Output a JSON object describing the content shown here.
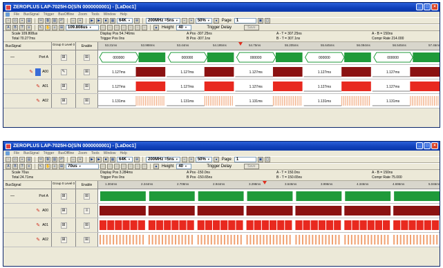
{
  "windows": [
    {
      "id": "win1",
      "title": "ZEROPLUS LAP-7025H-D(S/N 0000000001) - [LaDoc1]",
      "menu": [
        "File",
        "BusSignal",
        "Trigger",
        "BusOffline",
        "Zoom",
        "Tools",
        "Window",
        "Help"
      ],
      "toolbar1": {
        "mem_depth": "64K",
        "sample_rate": "200MHz =5ns",
        "zoom": "50%",
        "page_label": "Page",
        "page_value": "1"
      },
      "toolbar2": {
        "time_value": "109.808us",
        "height_label": "Height",
        "height_value": "40",
        "trigger_delay_label": "Trigger Delay",
        "trigger_delay_btn": "Save"
      },
      "status": {
        "scale": "Scale 109.808us",
        "total": "Total 70.277ms",
        "display_pos": "Display Pos 54.746ms",
        "trigger_pos": "Trigger Pos 0ns",
        "a_pos": "A Pos -307.25ns",
        "b_pos": "B Pos -307.1ns",
        "a_t": "A - T = 307.25ns",
        "b_t": "B - T = 307.1ns",
        "a_b": "A - B = 150ns",
        "compr": "Compr Rate 214.000"
      },
      "header": {
        "name": "BusSignal",
        "group": "Group 0 Level 0",
        "enable": "Enable"
      },
      "ruler": [
        "53.21ms",
        "53.988ms",
        "53.44ms",
        "54.195ms",
        "54.75ms",
        "55.205ms",
        "55.645ms",
        "56.094ms",
        "56.545ms",
        "57.46ms"
      ],
      "cursor_pos": 0.415,
      "rows": [
        {
          "name": "Port A",
          "type": "bus",
          "labels": [
            "000000",
            "000000",
            "000000",
            "000000",
            "000000"
          ]
        },
        {
          "name": "A00",
          "type": "a00",
          "labels": [
            "1.127ms",
            "1.127ms",
            "1.127ms",
            "1.127ms",
            "1.127ms"
          ]
        },
        {
          "name": "A01",
          "type": "a01",
          "labels": [
            "1.127ms",
            "1.127ms",
            "1.127ms",
            "1.127ms",
            "1.127ms"
          ]
        },
        {
          "name": "A02",
          "type": "a02",
          "labels": [
            "1.131ms",
            "1.131ms",
            "1.131ms",
            "1.131ms",
            "1.131ms"
          ]
        }
      ]
    },
    {
      "id": "win2",
      "title": "ZEROPLUS LAP-7025H-D(S/N 0000000001) - [LaDoc1]",
      "menu": [
        "File",
        "BusSignal",
        "Trigger",
        "BusOffline",
        "Zoom",
        "Tools",
        "Window",
        "Help"
      ],
      "toolbar1": {
        "mem_depth": "64K",
        "sample_rate": "200MHz =5ns",
        "zoom": "50%",
        "page_label": "Page",
        "page_value": "1"
      },
      "toolbar2": {
        "time_value": "70us",
        "height_label": "Height",
        "height_value": "40",
        "trigger_delay_label": "Trigger Delay",
        "trigger_delay_btn": "Save"
      },
      "status": {
        "scale": "Scale 70us",
        "total": "Total 24.71ms",
        "display_pos": "Display Pos 3.284ms",
        "trigger_pos": "Trigger Pos 0ns",
        "a_pos": "A Pos -150.0ns",
        "b_pos": "B Pos -150.65ns",
        "a_t": "A - T = 150.0ns",
        "b_t": "B - T = 150.65ns",
        "a_b": "A - B = 150ns",
        "compr": "Compr Rate 75.000"
      },
      "header": {
        "name": "BusSignal",
        "group": "Group 0 Level 0",
        "enable": "Enable"
      },
      "ruler": [
        "1.304ms",
        "2.244ms",
        "2.708ms",
        "2.944ms",
        "3.298ms",
        "3.646ms",
        "3.996ms",
        "4.346ms",
        "4.696ms",
        "5.046ms"
      ],
      "cursor_pos": 0.485,
      "rows": [
        {
          "name": "Port A",
          "type": "bus2",
          "labels": []
        },
        {
          "name": "A00",
          "type": "b00",
          "labels": []
        },
        {
          "name": "A01",
          "type": "b01",
          "labels": []
        },
        {
          "name": "A02",
          "type": "b02",
          "labels": []
        }
      ]
    }
  ],
  "colors": {
    "bus_green": "#1f9a3a",
    "a00_dark": "#8b1212",
    "a01_red": "#e8291f",
    "a02_orange": "#f0a070",
    "title_blue": "#0f3fb8"
  }
}
